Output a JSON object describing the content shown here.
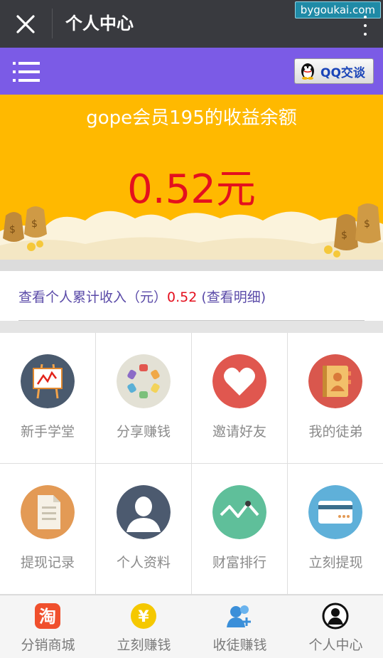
{
  "titlebar": {
    "title": "个人中心",
    "watermark": "bygoukai.com",
    "icons": [
      "close-icon",
      "more-icon"
    ]
  },
  "header": {
    "qq_button_label": "QQ交谈",
    "icons": [
      "menu-icon",
      "qq-penguin-icon"
    ],
    "accent": "#7b5be6"
  },
  "balance": {
    "title": "gope会员195的收益余额",
    "amount": "0.52元",
    "banner_color": "#ffb900",
    "amount_color": "#e4101e"
  },
  "income": {
    "prefix": "查看个人累计收入（元）",
    "value": "0.52",
    "suffix": " (查看明细)"
  },
  "grid": [
    {
      "label": "新手学堂",
      "icon": "easel-chart-icon",
      "color": "#4a5a6e"
    },
    {
      "label": "分享赚钱",
      "icon": "share-wheel-icon",
      "color": "#e3e1d5"
    },
    {
      "label": "邀请好友",
      "icon": "heart-icon",
      "color": "#e0574f"
    },
    {
      "label": "我的徒弟",
      "icon": "address-book-icon",
      "color": "#d9574d"
    },
    {
      "label": "提现记录",
      "icon": "document-icon",
      "color": "#e39a55"
    },
    {
      "label": "个人资料",
      "icon": "user-silhouette-icon",
      "color": "#4c5a6f"
    },
    {
      "label": "财富排行",
      "icon": "trend-line-icon",
      "color": "#5fbf9a"
    },
    {
      "label": "立刻提现",
      "icon": "bank-card-icon",
      "color": "#5fb0d9"
    }
  ],
  "tabbar": [
    {
      "label": "分销商城",
      "icon": "taobao-icon"
    },
    {
      "label": "立刻赚钱",
      "icon": "yen-coin-icon"
    },
    {
      "label": "收徒赚钱",
      "icon": "add-friend-icon"
    },
    {
      "label": "个人中心",
      "icon": "user-circle-icon"
    }
  ]
}
